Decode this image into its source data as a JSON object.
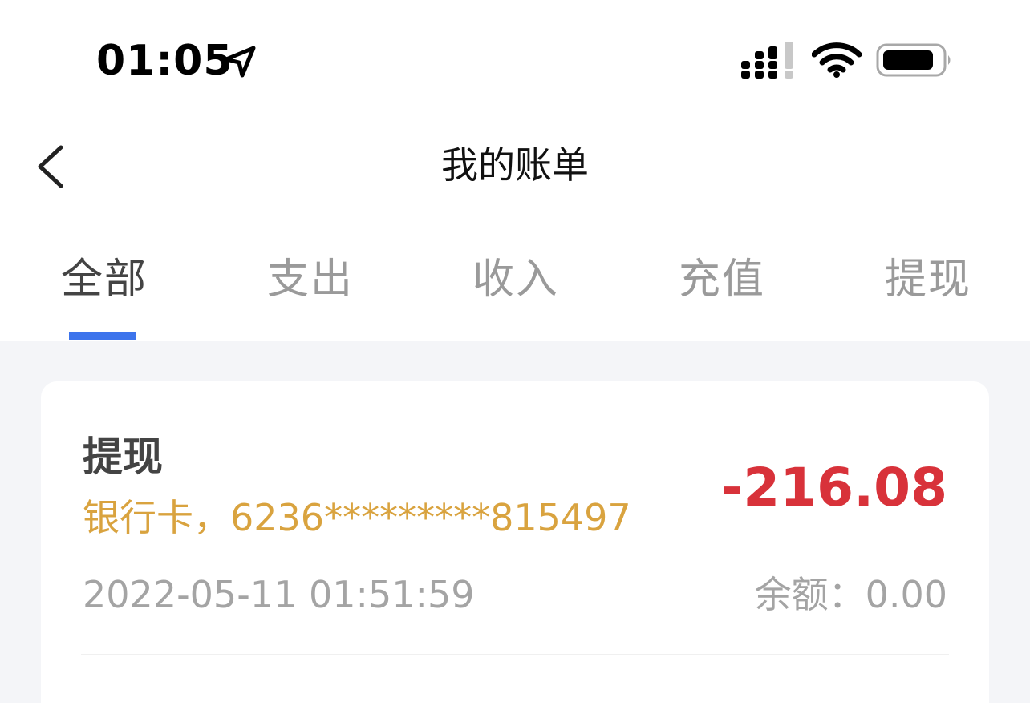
{
  "status_bar": {
    "time": "01:05",
    "icons": [
      "location-arrow-icon",
      "cellular-signal-icon",
      "wifi-icon",
      "battery-icon"
    ]
  },
  "nav": {
    "back_icon": "chevron-left-icon",
    "title": "我的账单"
  },
  "tabs": [
    {
      "label": "全部",
      "active": true
    },
    {
      "label": "支出",
      "active": false
    },
    {
      "label": "收入",
      "active": false
    },
    {
      "label": "充值",
      "active": false
    },
    {
      "label": "提现",
      "active": false
    }
  ],
  "records": [
    {
      "title": "提现",
      "account": "银行卡，6236*********815497",
      "amount": "-216.08",
      "datetime": "2022-05-11 01:51:59",
      "balance_label": "余额：",
      "balance": "0.00"
    }
  ],
  "colors": {
    "accent": "#3d74ec",
    "amount_negative": "#d8323a",
    "account_text": "#d9a33f",
    "muted_text": "#a4a4a4",
    "background": "#f4f5f8"
  }
}
